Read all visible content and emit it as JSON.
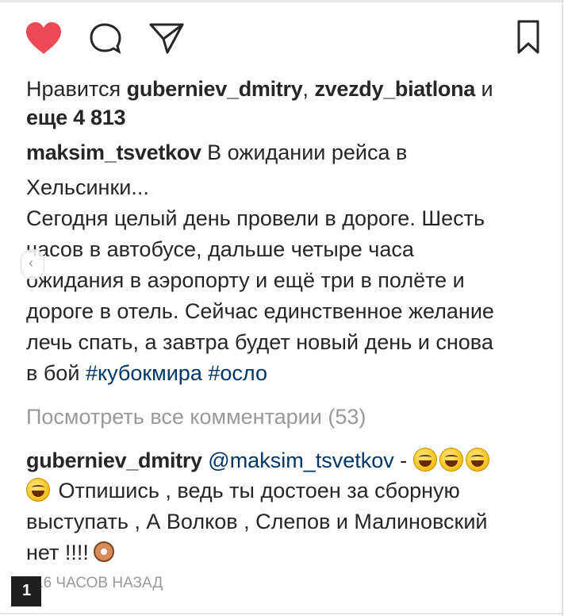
{
  "post": {
    "likes": {
      "prefix": "Нравится",
      "user1": "guberniev_dmitry",
      "separator": ",",
      "user2": "zvezdy_biatlona",
      "and": "и",
      "count_text": "еще 4 813"
    },
    "caption": {
      "author": "maksim_tsvetkov",
      "line1": "В ожидании рейса в",
      "line2": "Хельсинки...",
      "line3": "Сегодня целый день провели в дороге. Шесть",
      "line4": "часов в автобусе, дальше четыре часа",
      "line5": "ожидания в аэропорту и ещё три в полёте и",
      "line6": "дороге в отель. Сейчас единственное желание",
      "line7": "лечь спать, а завтра будет новый день и снова",
      "line8": "в бой",
      "hashtag1": "#кубокмира",
      "hashtag2": "#осло"
    },
    "view_comments": "Посмотреть все комментарии (53)",
    "comment": {
      "author": "guberniev_dmitry",
      "mention": "@maksim_tsvetkov",
      "dash": "-",
      "line2": "Отпишись , ведь ты достоен за сборную",
      "line3": "выступать , А Волков , Слепов и Малиновский",
      "line4": "нет !!!!"
    },
    "timestamp": "16 ЧАСОВ НАЗАД",
    "icons": {
      "like": "heart-icon",
      "comment": "comment-icon",
      "share": "share-icon",
      "save": "bookmark-icon"
    },
    "colors": {
      "like": "#ed4956",
      "hashtag": "#003569",
      "muted": "#999999",
      "text": "#262626"
    }
  }
}
